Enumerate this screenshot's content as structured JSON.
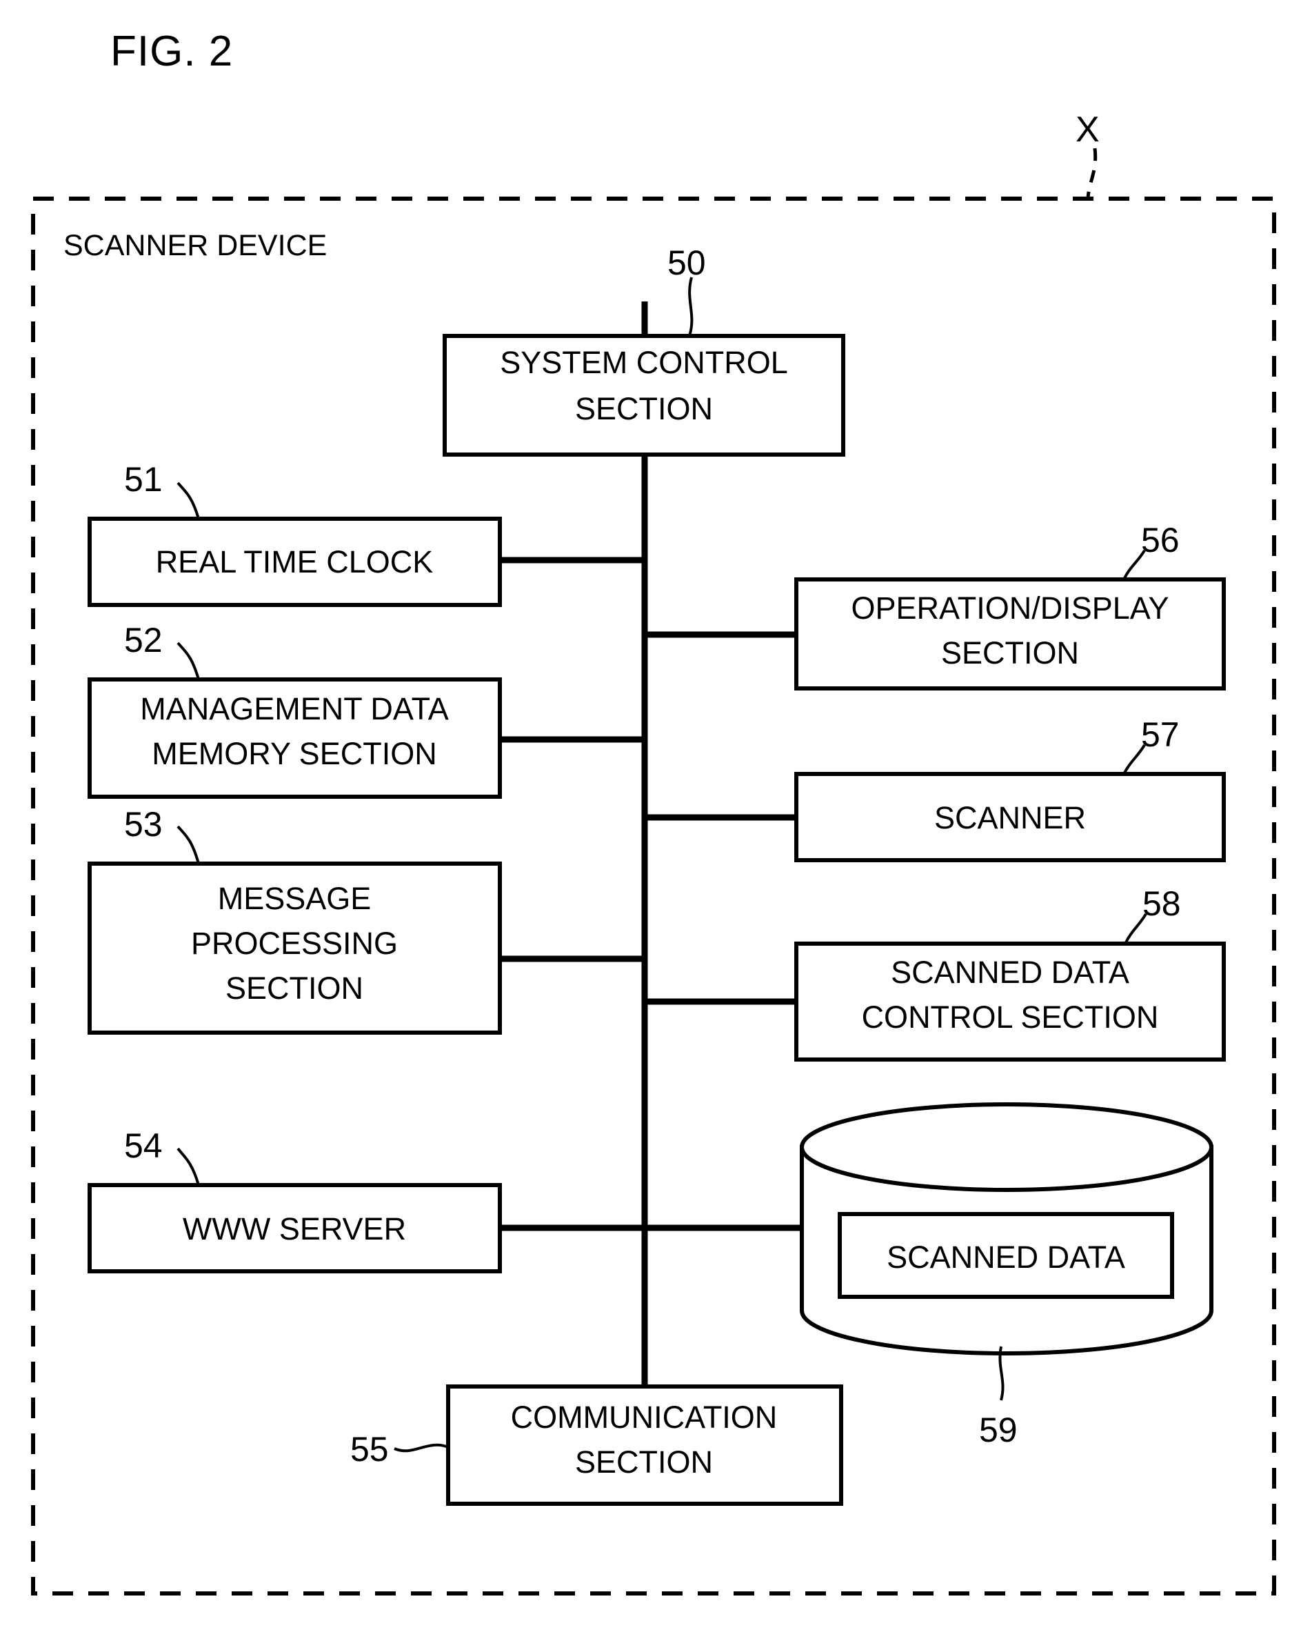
{
  "figure": {
    "title": "FIG. 2",
    "outer_label": "X",
    "container_label": "SCANNER DEVICE"
  },
  "blocks": [
    {
      "ref": "50",
      "label_lines": [
        "SYSTEM CONTROL",
        "SECTION"
      ],
      "label": "SYSTEM CONTROL SECTION"
    },
    {
      "ref": "51",
      "label_lines": [
        "REAL TIME CLOCK"
      ],
      "label": "REAL TIME CLOCK"
    },
    {
      "ref": "52",
      "label_lines": [
        "MANAGEMENT DATA",
        "MEMORY SECTION"
      ],
      "label": "MANAGEMENT DATA MEMORY SECTION"
    },
    {
      "ref": "53",
      "label_lines": [
        "MESSAGE",
        "PROCESSING",
        "SECTION"
      ],
      "label": "MESSAGE PROCESSING SECTION"
    },
    {
      "ref": "54",
      "label_lines": [
        "WWW SERVER"
      ],
      "label": "WWW SERVER"
    },
    {
      "ref": "55",
      "label_lines": [
        "COMMUNICATION",
        "SECTION"
      ],
      "label": "COMMUNICATION SECTION"
    },
    {
      "ref": "56",
      "label_lines": [
        "OPERATION/DISPLAY",
        "SECTION"
      ],
      "label": "OPERATION/DISPLAY SECTION"
    },
    {
      "ref": "57",
      "label_lines": [
        "SCANNER"
      ],
      "label": "SCANNER"
    },
    {
      "ref": "58",
      "label_lines": [
        "SCANNED DATA",
        "CONTROL SECTION"
      ],
      "label": "SCANNED DATA CONTROL SECTION"
    },
    {
      "ref": "59",
      "label_lines": [
        "SCANNED DATA"
      ],
      "label": "SCANNED DATA"
    }
  ],
  "colors": {
    "ink": "#000000",
    "paper": "#ffffff"
  }
}
